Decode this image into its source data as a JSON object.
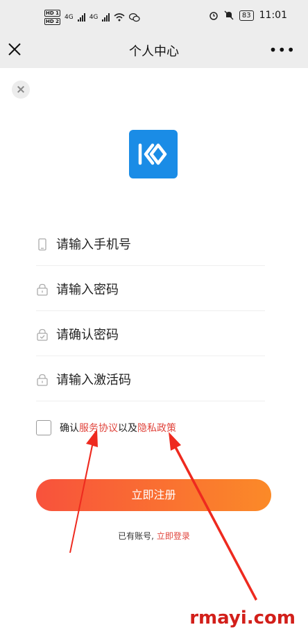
{
  "status_bar": {
    "hd1": "HD 1",
    "hd2": "HD 2",
    "net1": "4G",
    "net2": "4G",
    "battery": "83",
    "time": "11:01"
  },
  "navbar": {
    "title": "个人中心",
    "more": "•••"
  },
  "form": {
    "phone_placeholder": "请输入手机号",
    "password_placeholder": "请输入密码",
    "confirm_placeholder": "请确认密码",
    "activation_placeholder": "请输入激活码"
  },
  "agreement": {
    "prefix": "确认",
    "service_link": "服务协议",
    "middle": "以及",
    "privacy_link": "隐私政策"
  },
  "register_button": "立即注册",
  "login_hint": {
    "text": "已有账号, ",
    "link": "立即登录"
  },
  "watermark": "rmayi.com",
  "colors": {
    "accent_red": "#e0443c",
    "logo_blue": "#1a8ce6",
    "button_start": "#f8523c",
    "button_end": "#fb8a28"
  }
}
